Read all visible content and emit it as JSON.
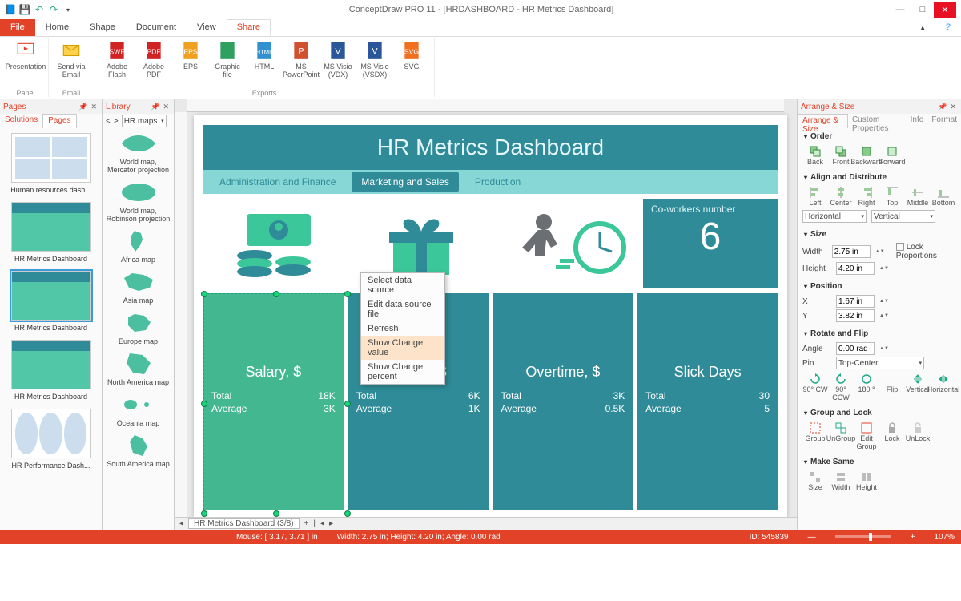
{
  "app": {
    "title": "ConceptDraw PRO 11 - [HRDASHBOARD - HR Metrics Dashboard]"
  },
  "menu": {
    "file": "File",
    "home": "Home",
    "shape": "Shape",
    "document": "Document",
    "view": "View",
    "share": "Share"
  },
  "ribbon": {
    "presentation": "Presentation",
    "send_email": "Send via Email",
    "flash": "Adobe Flash",
    "pdf": "Adobe PDF",
    "eps": "EPS",
    "graphic": "Graphic file",
    "html": "HTML",
    "ppt": "MS PowerPoint",
    "vdx": "MS Visio (VDX)",
    "vsdx": "MS Visio (VSDX)",
    "svg": "SVG",
    "g_panel": "Panel",
    "g_email": "Email",
    "g_exports": "Exports"
  },
  "pages": {
    "title": "Pages",
    "tabs": {
      "solutions": "Solutions",
      "pages": "Pages"
    },
    "items": [
      {
        "label": "Human resources dash..."
      },
      {
        "label": "HR Metrics Dashboard"
      },
      {
        "label": "HR Metrics Dashboard"
      },
      {
        "label": "HR Metrics Dashboard"
      },
      {
        "label": "HR Performance Dash..."
      }
    ]
  },
  "library": {
    "title": "Library",
    "selector": "HR maps",
    "items": [
      {
        "label": "World map, Mercator projection"
      },
      {
        "label": "World map, Robinson projection"
      },
      {
        "label": "Africa map"
      },
      {
        "label": "Asia map"
      },
      {
        "label": "Europe map"
      },
      {
        "label": "North America map"
      },
      {
        "label": "Oceania map"
      },
      {
        "label": "South America map"
      }
    ]
  },
  "canvas": {
    "title": "HR Metrics Dashboard",
    "tabs": {
      "a": "Administration and Finance",
      "b": "Marketing and Sales",
      "c": "Production"
    },
    "coworkers": {
      "label": "Co-workers number",
      "value": "6"
    },
    "metrics": [
      {
        "title": "Salary, $",
        "total_l": "Total",
        "total_v": "18K",
        "avg_l": "Average",
        "avg_v": "3K"
      },
      {
        "title": "Bonus, $",
        "total_l": "Total",
        "total_v": "6K",
        "avg_l": "Average",
        "avg_v": "1K"
      },
      {
        "title": "Overtime, $",
        "total_l": "Total",
        "total_v": "3K",
        "avg_l": "Average",
        "avg_v": "0.5K"
      },
      {
        "title": "Slick Days",
        "total_l": "Total",
        "total_v": "30",
        "avg_l": "Average",
        "avg_v": "5"
      }
    ],
    "ctx": {
      "a": "Select data source",
      "b": "Edit data source file",
      "c": "Refresh",
      "d": "Show Change value",
      "e": "Show Change percent"
    },
    "tabbar": "HR Metrics Dashboard (3/8)"
  },
  "right": {
    "title": "Arrange & Size",
    "tabs": {
      "a": "Arrange & Size",
      "b": "Custom Properties",
      "c": "Info",
      "d": "Format"
    },
    "order": {
      "h": "Order",
      "back": "Back",
      "front": "Front",
      "backward": "Backward",
      "forward": "Forward"
    },
    "align": {
      "h": "Align and Distribute",
      "left": "Left",
      "center": "Center",
      "right": "Right",
      "top": "Top",
      "middle": "Middle",
      "bottom": "Bottom",
      "horiz": "Horizontal",
      "vert": "Vertical"
    },
    "size": {
      "h": "Size",
      "w_l": "Width",
      "w_v": "2.75 in",
      "h_l": "Height",
      "h_v": "4.20 in",
      "lock": "Lock Proportions"
    },
    "pos": {
      "h": "Position",
      "x_l": "X",
      "x_v": "1.67 in",
      "y_l": "Y",
      "y_v": "3.82 in"
    },
    "rot": {
      "h": "Rotate and Flip",
      "a_l": "Angle",
      "a_v": "0.00 rad",
      "p_l": "Pin",
      "p_v": "Top-Center",
      "cw": "90° CW",
      "ccw": "90° CCW",
      "r180": "180 °",
      "flip": "Flip",
      "v": "Vertical",
      "hz": "Horizontal"
    },
    "grp": {
      "h": "Group and Lock",
      "group": "Group",
      "ungroup": "UnGroup",
      "editgroup": "Edit Group",
      "lock": "Lock",
      "unlock": "UnLock"
    },
    "make": {
      "h": "Make Same",
      "size": "Size",
      "width": "Width",
      "height": "Height"
    }
  },
  "status": {
    "mouse": "Mouse: [ 3.17, 3.71 ] in",
    "dims": "Width: 2.75 in;  Height: 4.20 in;  Angle: 0.00 rad",
    "id": "ID: 545839",
    "zoom": "107%"
  }
}
